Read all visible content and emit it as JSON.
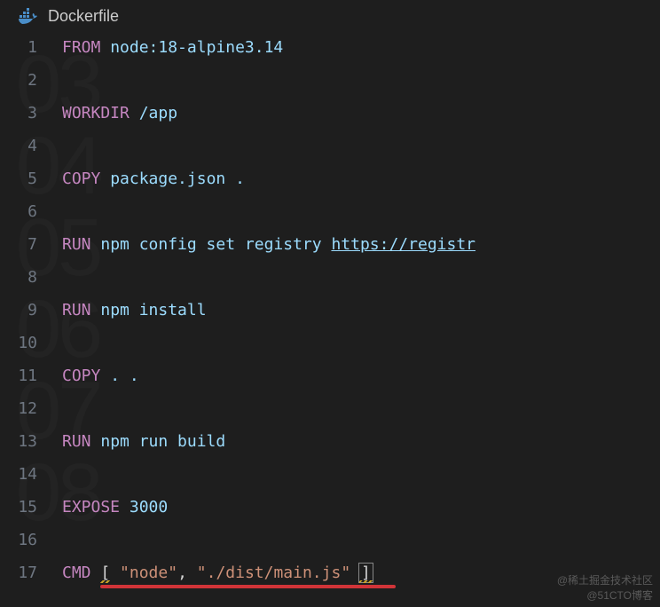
{
  "tab": {
    "title": "Dockerfile"
  },
  "lines": {
    "l1": {
      "num": "1",
      "kw": "FROM",
      "rest": " node:18-alpine3.14"
    },
    "l2": {
      "num": "2"
    },
    "l3": {
      "num": "3",
      "kw": "WORKDIR",
      "rest": " /app"
    },
    "l4": {
      "num": "4"
    },
    "l5": {
      "num": "5",
      "kw": "COPY",
      "rest": " package.json ."
    },
    "l6": {
      "num": "6"
    },
    "l7": {
      "num": "7",
      "kw": "RUN",
      "rest1": " npm config set registry ",
      "url": "https://registr"
    },
    "l8": {
      "num": "8"
    },
    "l9": {
      "num": "9",
      "kw": "RUN",
      "rest": " npm install"
    },
    "l10": {
      "num": "10"
    },
    "l11": {
      "num": "11",
      "kw": "COPY",
      "rest": " . ."
    },
    "l12": {
      "num": "12"
    },
    "l13": {
      "num": "13",
      "kw": "RUN",
      "rest": " npm run build"
    },
    "l14": {
      "num": "14"
    },
    "l15": {
      "num": "15",
      "kw": "EXPOSE",
      "rest": " 3000"
    },
    "l16": {
      "num": "16"
    },
    "l17": {
      "num": "17",
      "kw": "CMD",
      "sp": " ",
      "lb": "[",
      "sp2": " ",
      "s1": "\"node\"",
      "comma": ", ",
      "s2": "\"./dist/main.js\"",
      "sp3": " ",
      "rb": "]"
    }
  },
  "watermark": {
    "line1": "@稀土掘金技术社区",
    "line2": "@51CTO博客"
  }
}
